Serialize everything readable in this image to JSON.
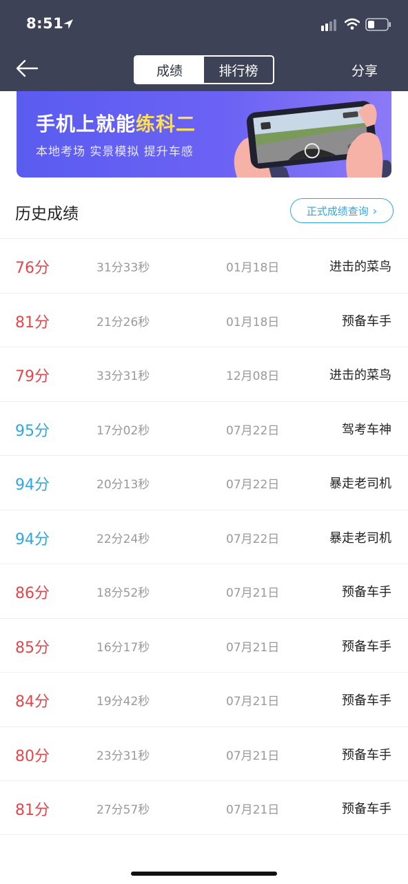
{
  "status_bar": {
    "time": "8:51"
  },
  "nav": {
    "tabs": [
      {
        "label": "成绩",
        "active": true
      },
      {
        "label": "排行榜",
        "active": false
      }
    ],
    "share_label": "分享"
  },
  "banner": {
    "title_main": "手机上就能",
    "title_highlight": "练科二",
    "subtitle": "本地考场 实景模拟 提升车感"
  },
  "history": {
    "title": "历史成绩",
    "query_label": "正式成绩查询",
    "colors": {
      "low": "#e2474b",
      "high": "#2ea7e0"
    },
    "records": [
      {
        "score": "76分",
        "duration": "31分33秒",
        "date": "01月18日",
        "rank_title": "进击的菜鸟",
        "tier": "red"
      },
      {
        "score": "81分",
        "duration": "21分26秒",
        "date": "01月18日",
        "rank_title": "预备车手",
        "tier": "red"
      },
      {
        "score": "79分",
        "duration": "33分31秒",
        "date": "12月08日",
        "rank_title": "进击的菜鸟",
        "tier": "red"
      },
      {
        "score": "95分",
        "duration": "17分02秒",
        "date": "07月22日",
        "rank_title": "驾考车神",
        "tier": "blue"
      },
      {
        "score": "94分",
        "duration": "20分13秒",
        "date": "07月22日",
        "rank_title": "暴走老司机",
        "tier": "blue"
      },
      {
        "score": "94分",
        "duration": "22分24秒",
        "date": "07月22日",
        "rank_title": "暴走老司机",
        "tier": "blue"
      },
      {
        "score": "86分",
        "duration": "18分52秒",
        "date": "07月21日",
        "rank_title": "预备车手",
        "tier": "red"
      },
      {
        "score": "85分",
        "duration": "16分17秒",
        "date": "07月21日",
        "rank_title": "预备车手",
        "tier": "red"
      },
      {
        "score": "84分",
        "duration": "19分42秒",
        "date": "07月21日",
        "rank_title": "预备车手",
        "tier": "red"
      },
      {
        "score": "80分",
        "duration": "23分31秒",
        "date": "07月21日",
        "rank_title": "预备车手",
        "tier": "red"
      },
      {
        "score": "81分",
        "duration": "27分57秒",
        "date": "07月21日",
        "rank_title": "预备车手",
        "tier": "red"
      }
    ]
  }
}
